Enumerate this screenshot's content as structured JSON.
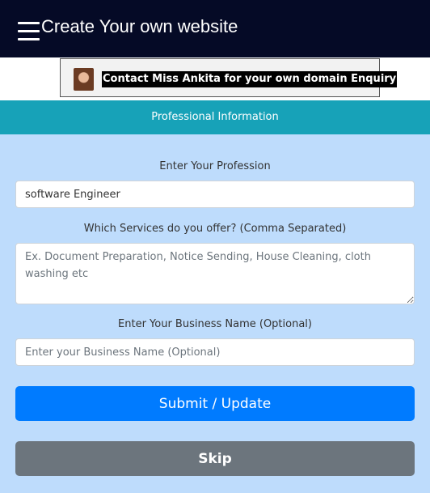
{
  "header": {
    "menu_icon": "hamburger-menu-icon",
    "title": "Create Your own website"
  },
  "banner": {
    "avatar_icon": "profile-photo",
    "text": "Contact Miss Ankita for your own domain Enquiry"
  },
  "section": {
    "title": "Professional Information"
  },
  "form": {
    "profession": {
      "label": "Enter Your Profession",
      "value": "software Engineer"
    },
    "services": {
      "label": "Which Services do you offer? (Comma Separated)",
      "placeholder": "Ex. Document Preparation, Notice Sending, House Cleaning, cloth washing etc"
    },
    "business": {
      "label": "Enter Your Business Name (Optional)",
      "placeholder": "Enter your Business Name (Optional)"
    },
    "submit_label": "Submit / Update",
    "skip_label": "Skip"
  },
  "colors": {
    "topbar": "#050a26",
    "section_header": "#17a2b8",
    "form_background": "#bedcfc",
    "submit_button": "#007bff",
    "skip_button": "#6c757d"
  }
}
